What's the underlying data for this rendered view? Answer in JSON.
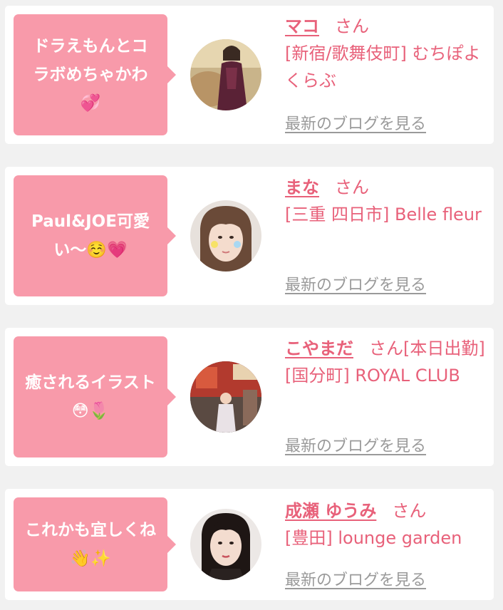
{
  "cards": [
    {
      "comment": "ドラえもんとコラボめちゃかわ💞",
      "name": "マコ",
      "honorific": "さん",
      "status": "",
      "shop": "[新宿/歌舞伎町] むちぽよくらぶ",
      "blog_link": "最新のブログを見る"
    },
    {
      "comment": "Paul&JOE可愛い〜☺️💗",
      "name": "まな",
      "honorific": "さん",
      "status": "",
      "shop": "[三重 四日市] Belle fleur",
      "blog_link": "最新のブログを見る"
    },
    {
      "comment": "癒されるイラスト😳🌷",
      "name": "こやまだ",
      "honorific": "さん",
      "status": "[本日出勤]",
      "shop": "[国分町] ROYAL CLUB",
      "blog_link": "最新のブログを見る"
    },
    {
      "comment": "これかも宜しくね👋✨",
      "name": "成瀬 ゆうみ",
      "honorific": "さん",
      "status": "",
      "shop": "[豊田] lounge garden",
      "blog_link": "最新のブログを見る"
    }
  ],
  "colors": {
    "accent": "#e8617a",
    "bubble": "#f89aaa",
    "link_gray": "#9a9a9a",
    "background": "#f1f1f1"
  }
}
